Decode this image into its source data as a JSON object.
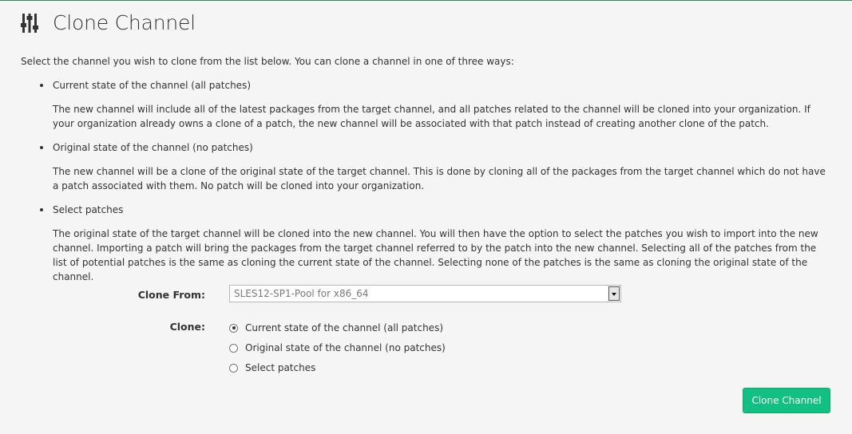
{
  "page": {
    "title": "Clone Channel",
    "header_icon": "sliders-icon"
  },
  "intro": "Select the channel you wish to clone from the list below. You can clone a channel in one of three ways:",
  "options": [
    {
      "title": "Current state of the channel (all patches)",
      "description": "The new channel will include all of the latest packages from the target channel, and all patches related to the channel will be cloned into your organization. If your organization already owns a clone of a patch, the new channel will be associated with that patch instead of creating another clone of the patch."
    },
    {
      "title": "Original state of the channel (no patches)",
      "description": "The new channel will be a clone of the original state of the target channel. This is done by cloning all of the packages from the target channel which do not have a patch associated with them. No patch will be cloned into your organization."
    },
    {
      "title": "Select patches",
      "description": "The original state of the target channel will be cloned into the new channel. You will then have the option to select the patches you wish to import into the new channel. Importing a patch will bring the packages from the target channel referred to by the patch into the new channel. Selecting all of the patches from the list of potential patches is the same as cloning the current state of the channel. Selecting none of the patches is the same as cloning the original state of the channel."
    }
  ],
  "form": {
    "clone_from_label": "Clone From:",
    "clone_from_value": "SLES12-SP1-Pool for x86_64",
    "clone_label": "Clone:",
    "radios": [
      {
        "label": "Current state of the channel (all patches)",
        "checked": true
      },
      {
        "label": "Original state of the channel (no patches)",
        "checked": false
      },
      {
        "label": "Select patches",
        "checked": false
      }
    ],
    "submit_label": "Clone Channel"
  },
  "colors": {
    "accent": "#12c083",
    "top_border": "#2e8b57",
    "background": "#f5f5f5"
  }
}
